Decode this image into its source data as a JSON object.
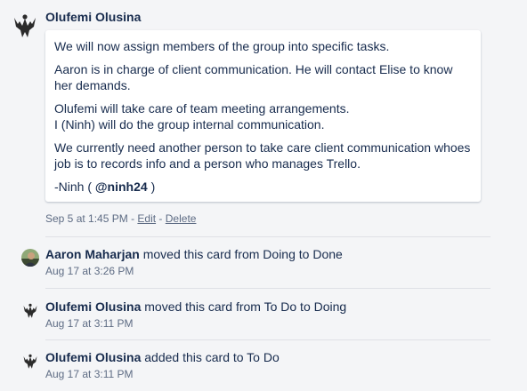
{
  "comment": {
    "author": "Olufemi Olusina",
    "paragraphs": [
      "We will now assign members of the group into specific tasks.",
      "Aaron is in charge of client communication. He will contact Elise to know her demands.",
      "Olufemi will take care of team meeting arrangements.",
      "I (Ninh) will do the group internal communication.",
      "We currently need another person to take care client communication whoes job is to records info and a person who manages Trello."
    ],
    "signature_prefix": "-Ninh ( ",
    "mention": "@ninh24",
    "signature_suffix": " )",
    "timestamp": "Sep 5 at 1:45 PM",
    "sep1": " - ",
    "edit_label": "Edit",
    "sep2": " - ",
    "delete_label": "Delete"
  },
  "activities": [
    {
      "user": "Aaron Maharjan",
      "action": "moved this card from Doing to Done",
      "time": "Aug 17 at 3:26 PM",
      "avatar": "photo-avatar"
    },
    {
      "user": "Olufemi Olusina",
      "action": "moved this card from To Do to Doing",
      "time": "Aug 17 at 3:11 PM",
      "avatar": "phoenix-icon"
    },
    {
      "user": "Olufemi Olusina",
      "action": "added this card to To Do",
      "time": "Aug 17 at 3:11 PM",
      "avatar": "phoenix-icon"
    }
  ],
  "colors": {
    "background": "#f4f5f7",
    "text": "#172b4d",
    "meta": "#5e6c84",
    "divider": "#dfe1e6"
  }
}
